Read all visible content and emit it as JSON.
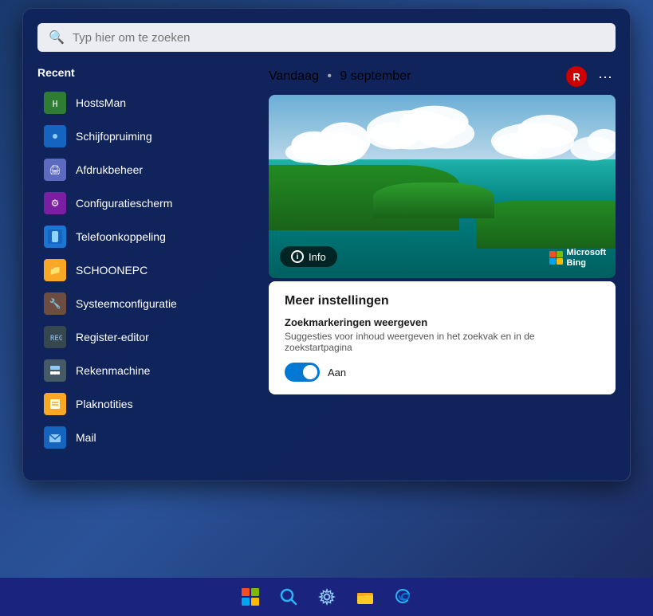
{
  "desktop": {
    "background": "#1a2a5e"
  },
  "startMenu": {
    "search": {
      "placeholder": "Typ hier om te zoeken"
    },
    "recent": {
      "label": "Recent",
      "apps": [
        {
          "id": "hostsman",
          "name": "HostsMan",
          "iconClass": "icon-hostsman",
          "icon": "🖥"
        },
        {
          "id": "schijf",
          "name": "Schijfopruiming",
          "iconClass": "icon-schijf",
          "icon": "💿"
        },
        {
          "id": "afdruk",
          "name": "Afdrukbeheer",
          "iconClass": "icon-afdruk",
          "icon": "🖨"
        },
        {
          "id": "config",
          "name": "Configuratiescherm",
          "iconClass": "icon-config",
          "icon": "⚙"
        },
        {
          "id": "telefoon",
          "name": "Telefoonkoppeling",
          "iconClass": "icon-telefoon",
          "icon": "📱"
        },
        {
          "id": "schoonepc",
          "name": "SCHOONEPC",
          "iconClass": "icon-schoonepc",
          "icon": "📁"
        },
        {
          "id": "systeem",
          "name": "Systeemconfiguratie",
          "iconClass": "icon-systeem",
          "icon": "🔧"
        },
        {
          "id": "register",
          "name": "Register-editor",
          "iconClass": "icon-register",
          "icon": "📝"
        },
        {
          "id": "rekenmachine",
          "name": "Rekenmachine",
          "iconClass": "icon-rekenmachine",
          "icon": "🔢"
        },
        {
          "id": "plaknotities",
          "name": "Plaknotities",
          "iconClass": "icon-plaknotities",
          "icon": "📌"
        },
        {
          "id": "mail",
          "name": "Mail",
          "iconClass": "icon-mail",
          "icon": "✉"
        }
      ]
    },
    "dateSection": {
      "vandaag": "Vandaag",
      "dot": "•",
      "date": "9 september",
      "userInitial": "R"
    },
    "wallpaper": {
      "infoLabel": "Info",
      "bingLabel": "Microsoft\nBing"
    },
    "meerInstellingen": {
      "title": "Meer instellingen",
      "zoekLabel": "Zoekmarkeringen weergeven",
      "zoekDesc": "Suggesties voor inhoud weergeven in het zoekvak en in de zoekstartpagina",
      "toggleLabel": "Aan",
      "toggleOn": true
    }
  },
  "taskbar": {
    "icons": [
      {
        "id": "windows",
        "label": "Start"
      },
      {
        "id": "search",
        "label": "Zoeken"
      },
      {
        "id": "settings",
        "label": "Instellingen"
      },
      {
        "id": "explorer",
        "label": "Verkenner"
      },
      {
        "id": "edge",
        "label": "Microsoft Edge"
      }
    ]
  }
}
